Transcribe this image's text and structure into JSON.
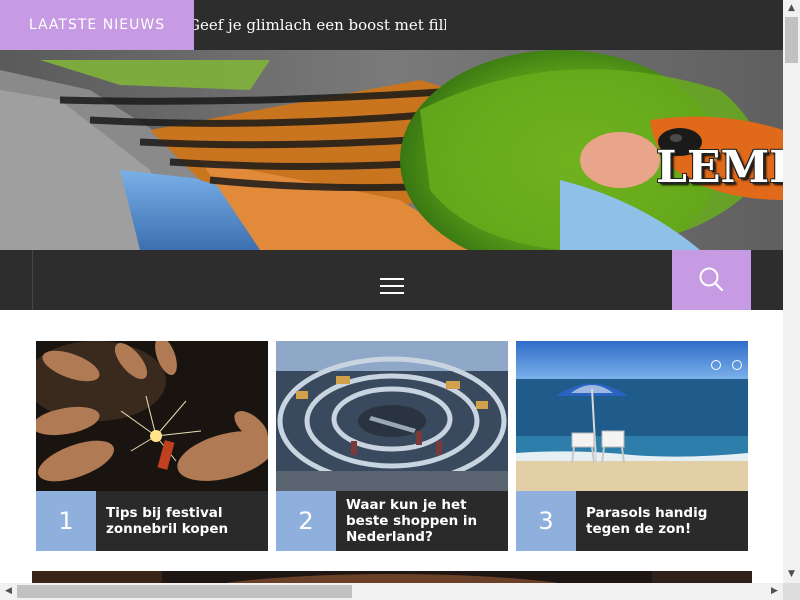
{
  "ticker": {
    "label": "LAATSTE NIEUWS",
    "headline": "Geef je glimlach een boost met fillers in"
  },
  "header": {
    "site_title": "LEMISSIONNAIRE",
    "banner_icon": "bird-photo"
  },
  "nav": {
    "menu_icon": "hamburger-icon",
    "search_icon": "search-icon"
  },
  "cards": [
    {
      "number": "1",
      "title": "Tips bij festival zonnebril kopen",
      "image": "sparkler-photo"
    },
    {
      "number": "2",
      "title": "Waar kun je het beste shoppen in Nederland?",
      "image": "shopping-mall-photo"
    },
    {
      "number": "3",
      "title": "Parasols handig tegen de zon!",
      "image": "beach-parasol-photo"
    }
  ],
  "slider": {
    "dot_count": 2
  },
  "colors": {
    "accent": "#c69be3",
    "dark": "#2d2d2d",
    "number_badge": "#8fb0dd"
  }
}
